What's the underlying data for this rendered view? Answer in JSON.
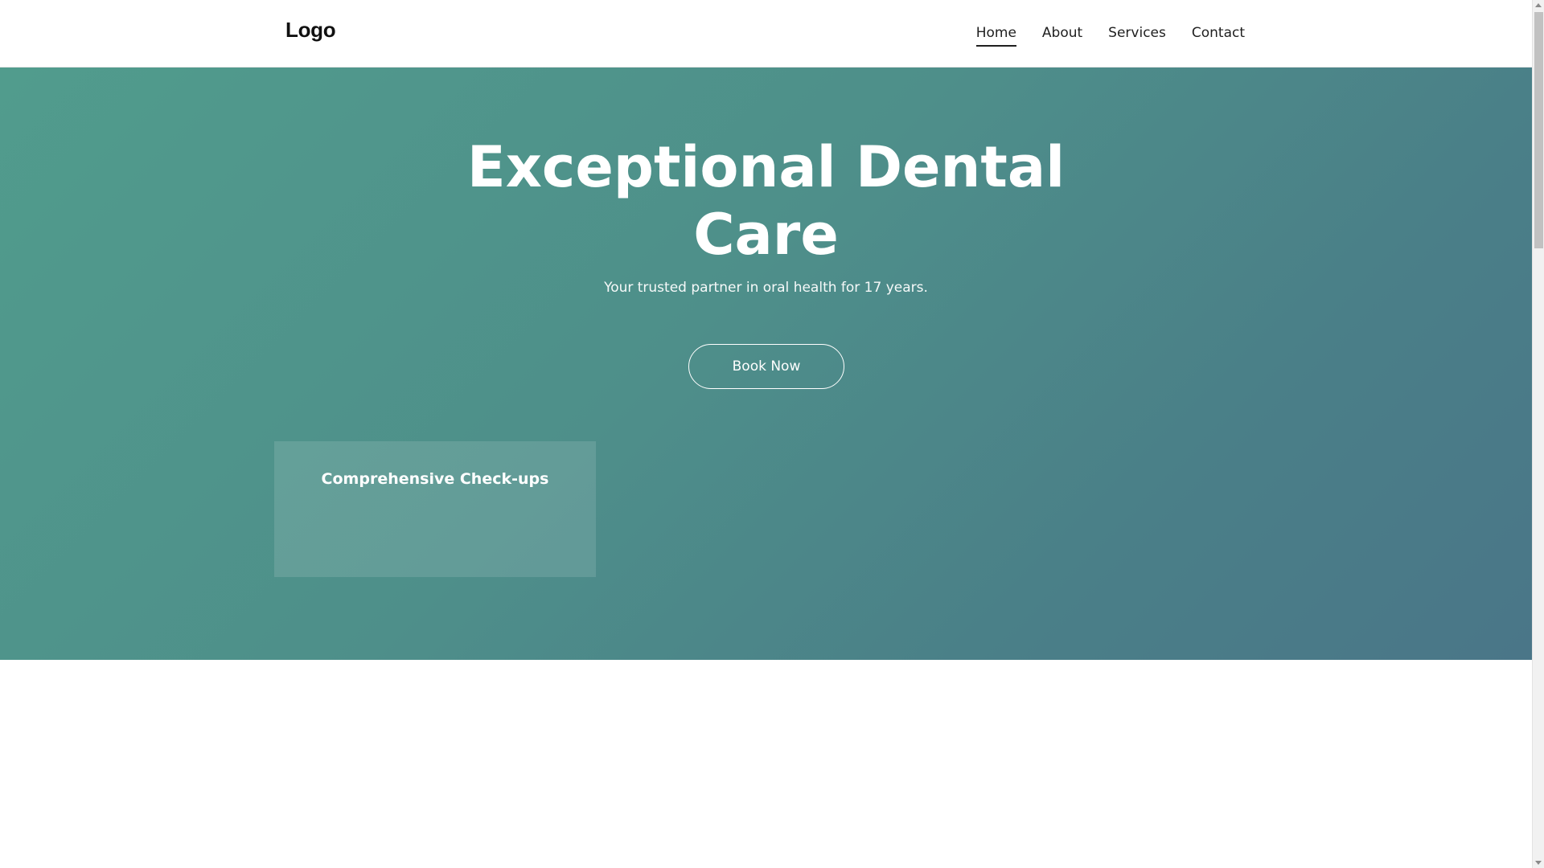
{
  "header": {
    "logo": "Logo",
    "nav": [
      {
        "label": "Home",
        "active": true
      },
      {
        "label": "About",
        "active": false
      },
      {
        "label": "Services",
        "active": false
      },
      {
        "label": "Contact",
        "active": false
      }
    ]
  },
  "hero": {
    "title_line1": "Exceptional Dental",
    "title_line2": "Care",
    "subtitle": "Your trusted partner in oral health for 17 years.",
    "cta_label": "Book Now",
    "gradient_start": "#519c8d",
    "gradient_end": "#4a7688"
  },
  "services": [
    {
      "title": "Comprehensive Check-ups"
    }
  ],
  "colors": {
    "text_dark": "#1f1f1f",
    "hero_text": "#ffffff"
  }
}
